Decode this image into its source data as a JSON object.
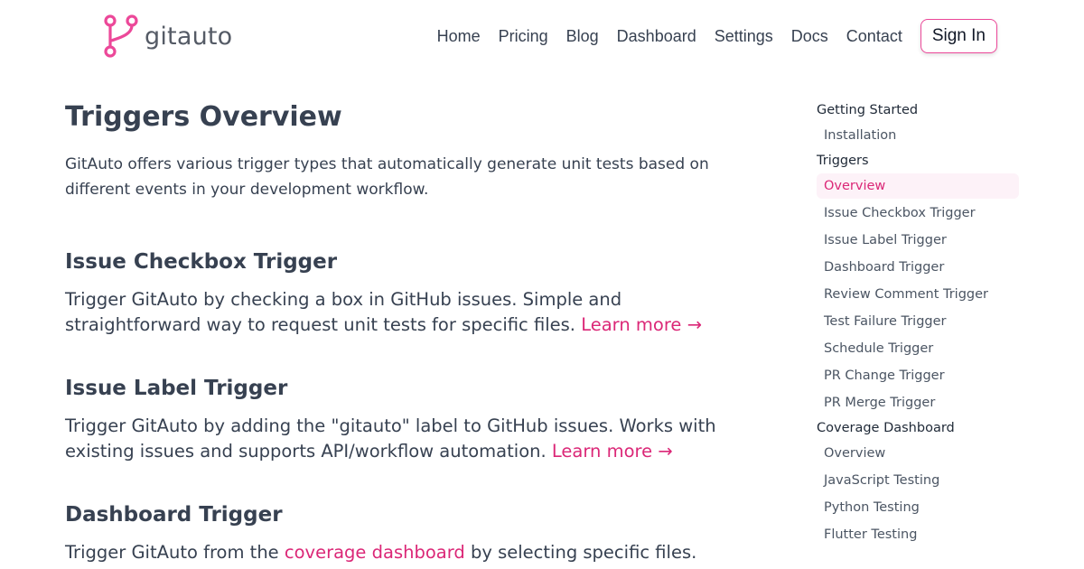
{
  "brand": {
    "name": "gitauto",
    "accent": "#ec4899",
    "link_color": "#db2777"
  },
  "nav": {
    "items": [
      "Home",
      "Pricing",
      "Blog",
      "Dashboard",
      "Settings",
      "Docs",
      "Contact"
    ],
    "sign_in": "Sign In"
  },
  "main": {
    "title": "Triggers Overview",
    "intro": "GitAuto offers various trigger types that automatically generate unit tests based on different events in your development workflow.",
    "sections": [
      {
        "title": "Issue Checkbox Trigger",
        "body": "Trigger GitAuto by checking a box in GitHub issues. Simple and straightforward way to request unit tests for specific files.",
        "link": "Learn more →"
      },
      {
        "title": "Issue Label Trigger",
        "body": "Trigger GitAuto by adding the \"gitauto\" label to GitHub issues. Works with existing issues and supports API/workflow automation.",
        "link": "Learn more →"
      },
      {
        "title": "Dashboard Trigger",
        "body_before": "Trigger GitAuto from the",
        "inline_link": "coverage dashboard",
        "body_after": "by selecting specific files. Perfect"
      }
    ]
  },
  "sidebar": {
    "groups": [
      {
        "label": "Getting Started",
        "items": [
          {
            "label": "Installation"
          }
        ]
      },
      {
        "label": "Triggers",
        "items": [
          {
            "label": "Overview",
            "active": true
          },
          {
            "label": "Issue Checkbox Trigger"
          },
          {
            "label": "Issue Label Trigger"
          },
          {
            "label": "Dashboard Trigger"
          },
          {
            "label": "Review Comment Trigger"
          },
          {
            "label": "Test Failure Trigger"
          },
          {
            "label": "Schedule Trigger"
          },
          {
            "label": "PR Change Trigger"
          },
          {
            "label": "PR Merge Trigger"
          }
        ]
      },
      {
        "label": "Coverage Dashboard",
        "items": [
          {
            "label": "Overview"
          },
          {
            "label": "JavaScript Testing"
          },
          {
            "label": "Python Testing"
          },
          {
            "label": "Flutter Testing"
          }
        ]
      }
    ]
  }
}
